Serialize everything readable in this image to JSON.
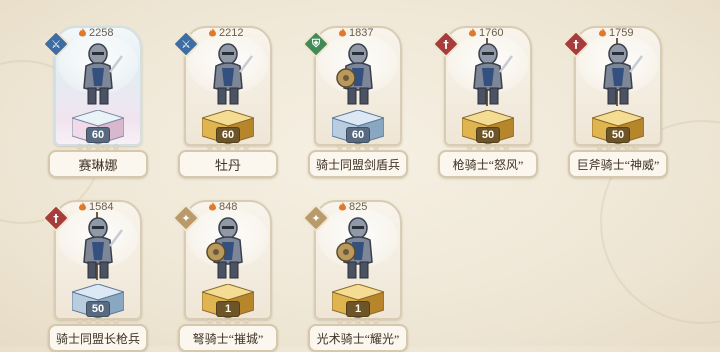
{
  "units": [
    {
      "name": "赛琳娜",
      "power": "2258",
      "level": "60",
      "stars": 5,
      "class_icon": "sword-cross-icon",
      "class_color": "#3d6da3",
      "rarity": "legendary",
      "pedestal": "pink"
    },
    {
      "name": "牡丹",
      "power": "2212",
      "level": "60",
      "stars": 5,
      "class_icon": "sword-cross-icon",
      "class_color": "#3d6da3",
      "rarity": "epic",
      "pedestal": "gold"
    },
    {
      "name": "骑士同盟剑盾兵",
      "power": "1837",
      "level": "60",
      "stars": 5,
      "class_icon": "shield-icon",
      "class_color": "#3f8a56",
      "rarity": "epic",
      "pedestal": "blue"
    },
    {
      "name": "枪骑士“怒风”",
      "power": "1760",
      "level": "50",
      "stars": 5,
      "class_icon": "lance-icon",
      "class_color": "#a63c3c",
      "rarity": "epic",
      "pedestal": "gold"
    },
    {
      "name": "巨斧骑士“神威”",
      "power": "1759",
      "level": "50",
      "stars": 5,
      "class_icon": "lance-icon",
      "class_color": "#a63c3c",
      "rarity": "epic",
      "pedestal": "gold"
    },
    {
      "name": "骑士同盟长枪兵",
      "power": "1584",
      "level": "50",
      "stars": 5,
      "class_icon": "lance-icon",
      "class_color": "#a63c3c",
      "rarity": "common",
      "pedestal": "blue"
    },
    {
      "name": "弩骑士“摧城”",
      "power": "848",
      "level": "1",
      "stars": 5,
      "class_icon": "crossbow-star-icon",
      "class_color": "#b89a6b",
      "rarity": "epic",
      "pedestal": "gold"
    },
    {
      "name": "光术骑士“耀光”",
      "power": "825",
      "level": "1",
      "stars": 5,
      "class_icon": "crossbow-star-icon",
      "class_color": "#b89a6b",
      "rarity": "epic",
      "pedestal": "gold"
    }
  ]
}
